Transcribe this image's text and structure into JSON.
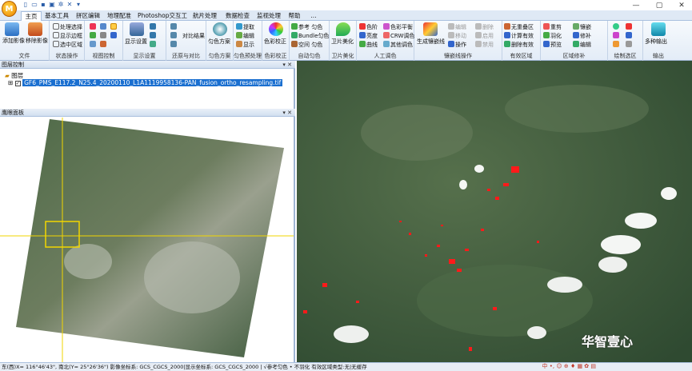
{
  "titlebar": {
    "win_min": "—",
    "win_max": "▢",
    "win_close": "✕",
    "dropdown": "▾"
  },
  "tabs": [
    "主页",
    "基本工具",
    "拼区编辑",
    "地理配准",
    "Photoshop交互工具",
    "航片处理",
    "数据检查",
    "监视处理",
    "帮助",
    "..."
  ],
  "ribbon": {
    "file": {
      "label": "文件",
      "add": "添加影像",
      "remove": "移除影像"
    },
    "state": {
      "label": "状态操作",
      "items": [
        "处理选择",
        "显示边框",
        "选中区域"
      ]
    },
    "view": {
      "label": "视图控制"
    },
    "display": {
      "label": "显示设置",
      "btn": "显示设置"
    },
    "restore": {
      "label": "还原与对比",
      "btn": "对比结果"
    },
    "uniform": {
      "label": "匀色方案",
      "btn": "匀色方案"
    },
    "preview": {
      "label": "匀色预处理",
      "items": [
        "提取",
        "编辑",
        "显示"
      ]
    },
    "colorcal": {
      "label": "色彩校正",
      "btn": "色彩校正"
    },
    "auto": {
      "label": "自动匀色",
      "items": [
        "参考 匀色",
        "Bundle匀色",
        "空间 匀色"
      ]
    },
    "satellite": {
      "label": "卫片美化",
      "btn": "卫片美化"
    },
    "manual": {
      "label": "人工调色",
      "items": [
        "色阶",
        "亮度",
        "曲线",
        "色彩平衡",
        "CRW调色",
        "其他调色"
      ]
    },
    "mosaic": {
      "label": "镶嵌线操作",
      "btn": "生成镶嵌线",
      "items": [
        "编辑",
        "移动",
        "操作",
        "删除",
        "启用",
        "禁用"
      ]
    },
    "valid": {
      "label": "有效区域",
      "items": [
        "无重叠区",
        "计算有效",
        "删除有效"
      ]
    },
    "mosaic_draw": {
      "label": "区域修补",
      "items": [
        "重剪",
        "羽化",
        "预览",
        "镶嵌",
        "修补",
        "编辑"
      ]
    },
    "draw": {
      "label": "绘制选区"
    },
    "output": {
      "label": "输出",
      "btn": "多种输出"
    }
  },
  "layers": {
    "title": "图层控制",
    "root": "图层",
    "file": "GF6_PMS_E117.2_N25.4_20200110_L1A1119958136-PAN_fusion_ortho_resampling.tif"
  },
  "eagle": {
    "title": "鹰眼面板"
  },
  "panel_controls": "▾ ✕",
  "status": {
    "text": "东(西)X= 116°46'43\", 南北(Y= 25°26'36\") 影像坐标系: GCS_CGCS_2000|显示坐标系: GCS_CGCS_2000 | √参考匀色 • 不羽化  有效区域类型:无|无缓存"
  },
  "watermark": "华智壹心",
  "tray": "中 •, ☺ ⊕ ♦ ▦ ✿ ▤",
  "colors": {
    "accent": "#2b5ea8",
    "highlight": "#ff1a1a",
    "crosshair": "#f2d600"
  }
}
